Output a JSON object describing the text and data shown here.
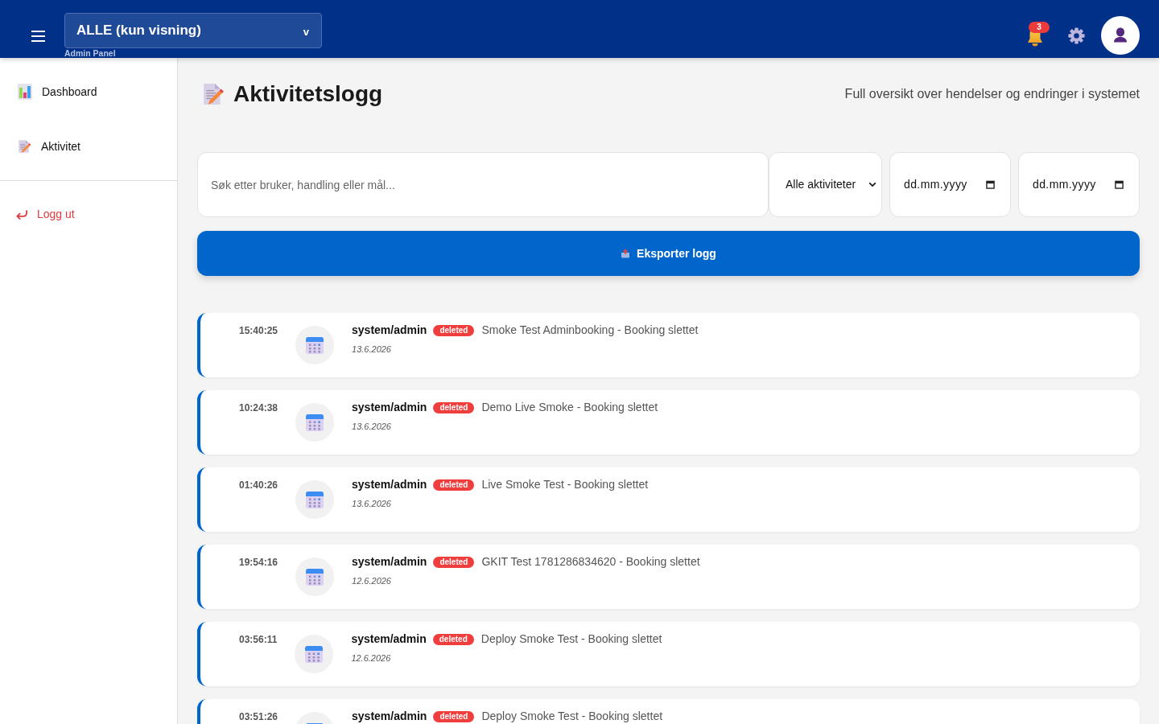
{
  "header": {
    "scope_selector": {
      "value": "ALLE (kun visning)",
      "caret": "v"
    },
    "caption": "Admin Panel",
    "notifications": {
      "count": "3"
    }
  },
  "sidebar": {
    "items": [
      {
        "label": "Dashboard"
      },
      {
        "label": "Aktivitet"
      }
    ],
    "logout": {
      "label": "Logg ut"
    }
  },
  "page": {
    "title": "Aktivitetslogg",
    "subtitle": "Full oversikt over hendelser og endringer i systemet"
  },
  "filters": {
    "search": {
      "placeholder": "Søk etter bruker, handling eller mål..."
    },
    "activity_type": {
      "value": "Alle aktiviteter"
    },
    "date_from": {
      "placeholder": "dd.mm.yyyy"
    },
    "date_to": {
      "placeholder": "dd.mm.yyyy"
    }
  },
  "export_button": {
    "label": "Eksporter logg"
  },
  "log_entries": [
    {
      "time": "15:40:25",
      "user": "system/admin",
      "action_type": "deleted",
      "description": "Smoke Test Adminbooking - Booking slettet",
      "date": "13.6.2026"
    },
    {
      "time": "10:24:38",
      "user": "system/admin",
      "action_type": "deleted",
      "description": "Demo Live Smoke - Booking slettet",
      "date": "13.6.2026"
    },
    {
      "time": "01:40:26",
      "user": "system/admin",
      "action_type": "deleted",
      "description": "Live Smoke Test - Booking slettet",
      "date": "13.6.2026"
    },
    {
      "time": "19:54:16",
      "user": "system/admin",
      "action_type": "deleted",
      "description": "GKIT Test 1781286834620 - Booking slettet",
      "date": "12.6.2026"
    },
    {
      "time": "03:56:11",
      "user": "system/admin",
      "action_type": "deleted",
      "description": "Deploy Smoke Test - Booking slettet",
      "date": "12.6.2026"
    },
    {
      "time": "03:51:26",
      "user": "system/admin",
      "action_type": "deleted",
      "description": "Deploy Smoke Test - Booking slettet"
    }
  ]
}
